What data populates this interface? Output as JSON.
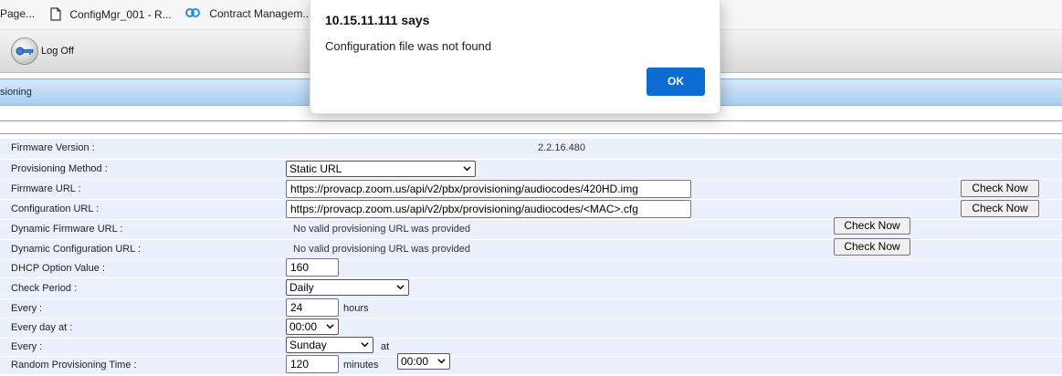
{
  "bookmarks": [
    {
      "label": "Page..."
    },
    {
      "label": "ConfigMgr_001 - R..."
    },
    {
      "label": "Contract Managem..."
    }
  ],
  "toolbar": {
    "logoff_label": "Log Off"
  },
  "page_title": "sioning",
  "form": {
    "firmware_version": {
      "label": "Firmware Version :",
      "value": "2.2.16.480"
    },
    "provisioning_method": {
      "label": "Provisioning Method :",
      "value": "Static URL"
    },
    "firmware_url": {
      "label": "Firmware URL :",
      "value": "https://provacp.zoom.us/api/v2/pbx/provisioning/audiocodes/420HD.img",
      "button": "Check Now"
    },
    "configuration_url": {
      "label": "Configuration URL :",
      "value": "https://provacp.zoom.us/api/v2/pbx/provisioning/audiocodes/<MAC>.cfg",
      "button": "Check Now"
    },
    "dynamic_firmware_url": {
      "label": "Dynamic Firmware URL :",
      "value": "No valid provisioning URL was provided",
      "button": "Check Now"
    },
    "dynamic_configuration_url": {
      "label": "Dynamic Configuration URL :",
      "value": "No valid provisioning URL was provided",
      "button": "Check Now"
    },
    "dhcp_option": {
      "label": "DHCP Option Value :",
      "value": "160"
    },
    "check_period": {
      "label": "Check Period :",
      "value": "Daily"
    },
    "every_hours": {
      "label": "Every :",
      "value": "24",
      "unit": "hours"
    },
    "every_day_at": {
      "label": "Every day at :",
      "value": "00:00"
    },
    "every_weekday": {
      "label": "Every :",
      "day": "Sunday",
      "at_label": "at",
      "time": "00:00"
    },
    "random_time": {
      "label": "Random Provisioning Time :",
      "value": "120",
      "unit": "minutes"
    }
  },
  "dialog": {
    "title": "10.15.11.111 says",
    "message": "Configuration file was not found",
    "ok_label": "OK"
  }
}
